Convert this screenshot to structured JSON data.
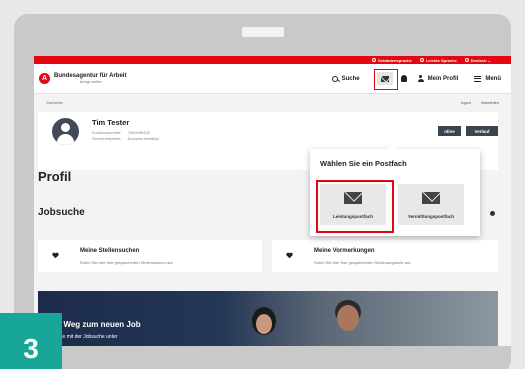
{
  "utility_bar": {
    "items": [
      "Gebärdensprache",
      "Leichte Sprache",
      "Deutsch"
    ]
  },
  "header": {
    "logo_title": "Bundesagentur für Arbeit",
    "logo_sub": "bringt weiter.",
    "search_label": "Suche",
    "profile_label": "Mein Profil",
    "menu_label": "Menü"
  },
  "breadcrumb": "Startseite",
  "subnav_right": [
    "Ingen",
    "Abmelden"
  ],
  "profile": {
    "name": "Tim Tester",
    "customer_label": "Kundennummer:",
    "customer_value": "7050096432",
    "security_label": "Sicherheitsstufe:",
    "security_value": "Ausweis bestätigt",
    "page_title": "Profil",
    "btn_online": "nline",
    "btn_verlauf": "Verlauf"
  },
  "popover": {
    "title": "Wählen Sie ein Postfach",
    "options": [
      {
        "label": "Leistungspostfach",
        "selected": true
      },
      {
        "label": "Vermittlungspostfach",
        "selected": false
      }
    ]
  },
  "section": {
    "title": "Jobsuche"
  },
  "tiles": [
    {
      "title": "Meine Stellensuchen",
      "desc": "Rufen Sie hier Ihre gespeicherten Stellensuchen auf."
    },
    {
      "title": "Meine Vormerkungen",
      "desc": "Rufen Sie hier Ihre gespeicherten Stellenangebote auf."
    }
  ],
  "banner": {
    "title": "Ihr Weg zum neuen Job",
    "sub": "en Sie mit der Jobsuche unter"
  },
  "step_number": "3",
  "colors": {
    "brand_red": "#e30613",
    "dark_button": "#3d4451",
    "step_badge": "#17a697"
  }
}
